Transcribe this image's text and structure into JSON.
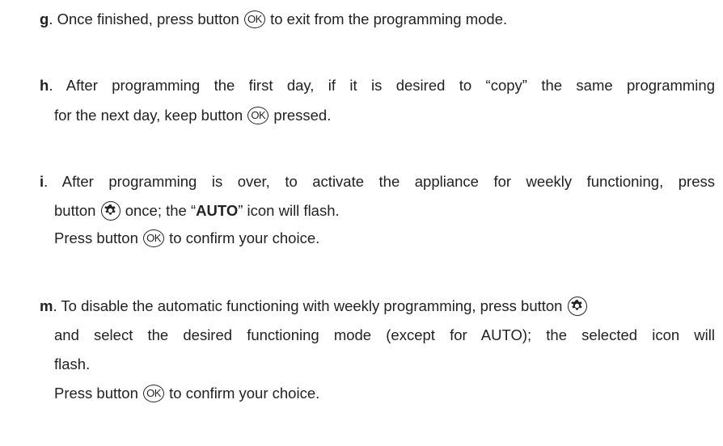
{
  "icons": {
    "ok_button": "ok-button-icon",
    "mode_button": "gear-button-icon",
    "ok_glyph": "OK"
  },
  "g": {
    "letter": "g",
    "l1a": ". Once finished, press button",
    "l1b": "to exit from the programming mode."
  },
  "h": {
    "letter": "h",
    "l1": ". After programming the first day, if it is desired to “copy” the same programming",
    "l2a": "for the next day, keep button",
    "l2b": "pressed."
  },
  "i": {
    "letter": "i",
    "l1": ". After programming is over, to activate the appliance for weekly functioning, press",
    "l2a": "button",
    "l2b": "once; the “",
    "l2c": "AUTO",
    "l2d": "” icon will flash.",
    "l3a": "Press button",
    "l3b": "to confirm your choice."
  },
  "m": {
    "letter": "m",
    "l1": ". To disable the automatic functioning with weekly programming, press button",
    "l2": "and select the desired functioning mode (except for AUTO); the selected icon will",
    "l3": "flash.",
    "l4a": "Press button",
    "l4b": "to confirm your choice."
  }
}
